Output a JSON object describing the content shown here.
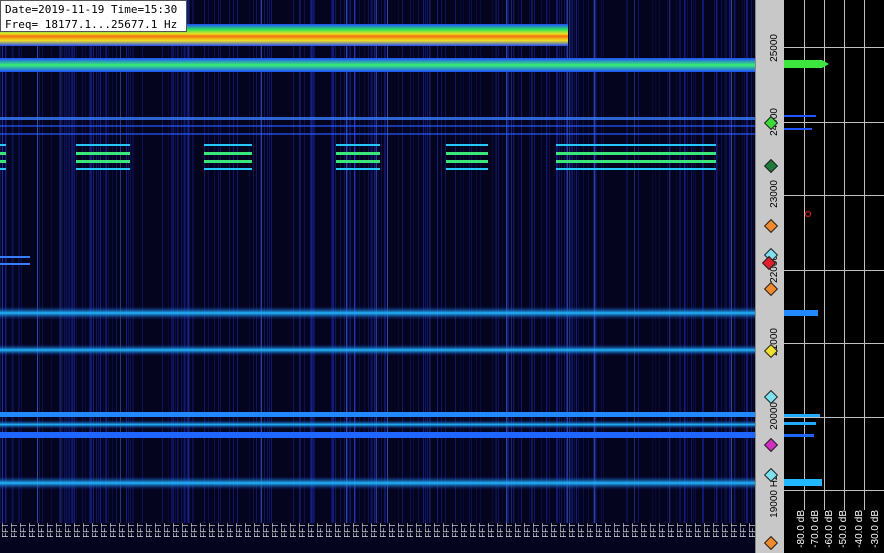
{
  "info": {
    "line1": "Date=2019-11-19 Time=15:30",
    "line2": "Freq= 18177.1...25677.1 Hz"
  },
  "freq_axis": {
    "labels": [
      "25000",
      "24000",
      "23000",
      "22000",
      "21000",
      "20000",
      "19000 Hz"
    ]
  },
  "db_axis": {
    "labels": [
      "-80.0 dB",
      "-70.0 dB",
      "-60.0 dB",
      "-50.0 dB",
      "-40.0 dB",
      "-30.0 dB"
    ]
  },
  "time_axis": {
    "label_text": "FFT"
  },
  "colors": {
    "background": "#04041e",
    "signal_blue": "#1e6cff",
    "signal_cyan": "#22d6ff",
    "signal_green": "#2ee65a",
    "signal_yellow": "#f0e020",
    "signal_red": "#e53a10"
  },
  "station_markers": [
    {
      "color": "#3cd83c",
      "icon": "green-diamond-icon"
    },
    {
      "color": "#1f7a3c",
      "icon": "darkgreen-diamond-icon"
    },
    {
      "color": "#f08a30",
      "icon": "orange-diamond-icon"
    },
    {
      "color": "#7fe0f0",
      "icon": "cyan-diamond-icon"
    },
    {
      "color": "#e02030",
      "icon": "red-diamond-icon"
    },
    {
      "color": "#f08a30",
      "icon": "orange-diamond-icon"
    },
    {
      "color": "#f0e030",
      "icon": "yellow-diamond-icon"
    },
    {
      "color": "#7fe0f0",
      "icon": "cyan-diamond-icon"
    },
    {
      "color": "#d030c0",
      "icon": "magenta-diamond-icon"
    },
    {
      "color": "#7fe0f0",
      "icon": "cyan-diamond-icon"
    },
    {
      "color": "#f08a30",
      "icon": "orange-diamond-icon"
    }
  ]
}
